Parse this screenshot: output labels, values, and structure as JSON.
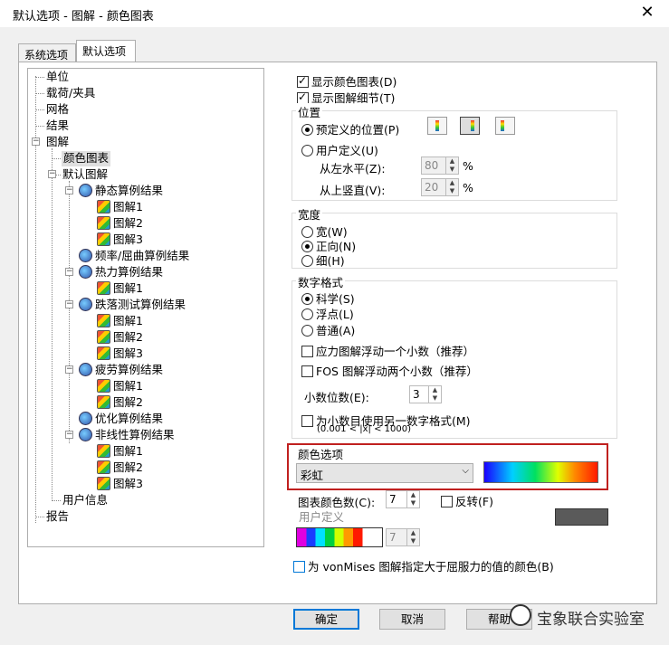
{
  "window": {
    "title": "默认选项 - 图解 - 颜色图表",
    "close_glyph": "✕"
  },
  "tabs": [
    {
      "label": "系统选项"
    },
    {
      "label": "默认选项"
    }
  ],
  "tree": {
    "units": "单位",
    "loads": "载荷/夹具",
    "mesh": "网格",
    "results": "结果",
    "plot": "图解",
    "color_chart": "颜色图表",
    "default_plots": "默认图解",
    "static": "静态算例结果",
    "freq": "频率/屈曲算例结果",
    "thermal": "热力算例结果",
    "drop": "跌落测试算例结果",
    "fatigue": "疲劳算例结果",
    "optim": "优化算例结果",
    "nonlinear": "非线性算例结果",
    "plot1": "图解1",
    "plot2": "图解2",
    "plot3": "图解3",
    "user_info": "用户信息",
    "report": "报告"
  },
  "options": {
    "show_color_chart": "显示颜色图表(D)",
    "show_plot_details": "显示图解细节(T)",
    "position": {
      "title": "位置",
      "predefined": "预定义的位置(P)",
      "user_defined": "用户定义(U)",
      "from_left": "从左水平(Z):",
      "from_top": "从上竖直(V):",
      "left_value": "80",
      "top_value": "20",
      "unit": "%"
    },
    "width": {
      "title": "宽度",
      "wide": "宽(W)",
      "normal": "正向(N)",
      "thin": "细(H)"
    },
    "number_format": {
      "title": "数字格式",
      "scientific": "科学(S)",
      "floating": "浮点(L)",
      "general": "普通(A)",
      "stress_float": "应力图解浮动一个小数（推荐）",
      "fos_float": "FOS 图解浮动两个小数（推荐）",
      "decimals_label": "小数位数(E):",
      "decimals_value": "3",
      "alt_format": "为小数目使用另一数字格式(M)",
      "alt_range": "(0.001 < |x| < 1000)"
    },
    "color_options": {
      "title": "颜色选项",
      "scheme": "彩虹",
      "count_label": "图表颜色数(C):",
      "count_value": "7",
      "reverse": "反转(F)",
      "user_defined": "用户定义",
      "user_count": "7",
      "swatch_color": "#5a5a5a"
    },
    "vonmises": "为 vonMises 图解指定大于屈服力的值的颜色(B)"
  },
  "buttons": {
    "ok": "确定",
    "cancel": "取消",
    "help": "帮助"
  },
  "watermark": "宝象联合实验室",
  "colors": {
    "highlight": "#c0201f",
    "default_btn": "#0078d7"
  }
}
